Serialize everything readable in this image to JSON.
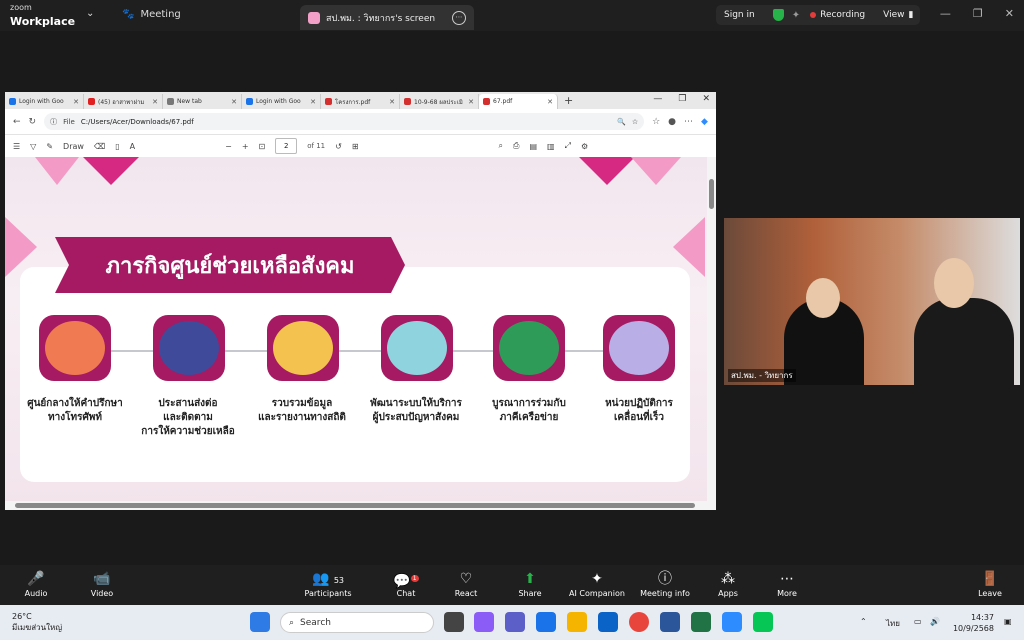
{
  "zoom": {
    "logo_small": "zoom",
    "logo_big": "Workplace",
    "meeting_label": "Meeting",
    "share_tab_title": "สป.พม. : วิทยากร's screen",
    "signin": "Sign in",
    "recording": "Recording",
    "view": "View"
  },
  "browser": {
    "tabs": [
      {
        "label": "Login with Goo",
        "color": "#1a73e8"
      },
      {
        "label": "(45) อาสาพาฝาม",
        "color": "#e02020"
      },
      {
        "label": "New tab",
        "color": "#777777"
      },
      {
        "label": "Login with Goo",
        "color": "#1a73e8"
      },
      {
        "label": "โครงการ.pdf",
        "color": "#d32f2f"
      },
      {
        "label": "10-9-68 ผลประเมิ",
        "color": "#d32f2f"
      },
      {
        "label": "67.pdf",
        "color": "#d32f2f"
      }
    ],
    "url_prefix": "File",
    "url": "C:/Users/Acer/Downloads/67.pdf",
    "draw_label": "Draw",
    "page_current": "2",
    "page_total": "of 11"
  },
  "slide": {
    "title": "ภารกิจศูนย์ช่วยเหลือสังคม",
    "items": [
      {
        "label": "ศูนย์กลางให้คำปรึกษา\nทางโทรศัพท์",
        "color": "#f07a52"
      },
      {
        "label": "ประสานส่งต่อ\nและติดตาม\nการให้ความช่วยเหลือ",
        "color": "#3f4a9a"
      },
      {
        "label": "รวบรวมข้อมูล\nและรายงานทางสถิติ",
        "color": "#f4c24e"
      },
      {
        "label": "พัฒนาระบบให้บริการ\nผู้ประสบปัญหาสังคม",
        "color": "#8fd3df"
      },
      {
        "label": "บูรณาการร่วมกับ\nภาคีเครือข่าย",
        "color": "#2f9b58"
      },
      {
        "label": "หน่วยปฏิบัติการ\nเคลื่อนที่เร็ว",
        "color": "#b9aee5"
      }
    ]
  },
  "video": {
    "name": "สป.พม. - วิทยากร"
  },
  "controls": [
    {
      "label": "Audio",
      "icon": "🎤"
    },
    {
      "label": "Video",
      "icon": "📹"
    },
    {
      "label": "Participants",
      "icon": "👥",
      "count": "53"
    },
    {
      "label": "Chat",
      "icon": "💬",
      "badge": "1"
    },
    {
      "label": "React",
      "icon": "♡"
    },
    {
      "label": "Share",
      "icon": "⬆"
    },
    {
      "label": "AI Companion",
      "icon": "✦"
    },
    {
      "label": "Meeting info",
      "icon": "ⓘ"
    },
    {
      "label": "Apps",
      "icon": "⁂"
    },
    {
      "label": "More",
      "icon": "⋯"
    },
    {
      "label": "Leave",
      "icon": "🚪"
    }
  ],
  "taskbar": {
    "weather_temp": "26°C",
    "weather_desc": "มีเมฆส่วนใหญ่",
    "search": "Search",
    "lang": "ไทย",
    "time": "14:37",
    "date": "10/9/2568"
  }
}
